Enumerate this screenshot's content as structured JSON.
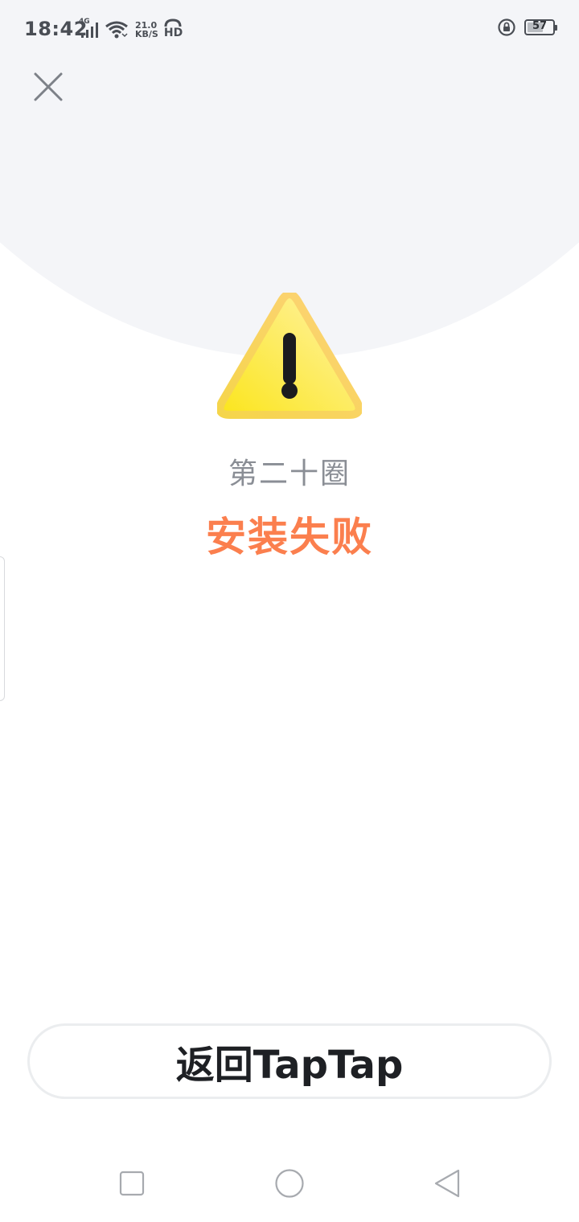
{
  "status_bar": {
    "time": "18:42",
    "network_type": "4G",
    "net_speed_value": "21.0",
    "net_speed_unit": "KB/S",
    "hd_label": "HD",
    "battery_level": "57",
    "icons": [
      "signal-icon",
      "wifi-icon",
      "hd-call-icon",
      "rotation-lock-icon",
      "battery-icon"
    ]
  },
  "header": {
    "close_icon": "close-icon"
  },
  "result": {
    "icon": "warning-triangle-icon",
    "app_name": "第二十圈",
    "status_text": "安装失败",
    "status_color": "#fb7f4e"
  },
  "actions": {
    "return_button_label": "返回TapTap"
  },
  "navigation_bar": {
    "buttons": [
      "recent-apps-icon",
      "home-icon",
      "back-icon"
    ]
  },
  "colors": {
    "header_background": "#f4f5f8",
    "warning_fill_start": "#fbe51c",
    "warning_fill_end": "#fff3a8",
    "warning_border": "#fdd27a",
    "text_secondary": "#8a8e95",
    "button_text": "#1e2024"
  }
}
